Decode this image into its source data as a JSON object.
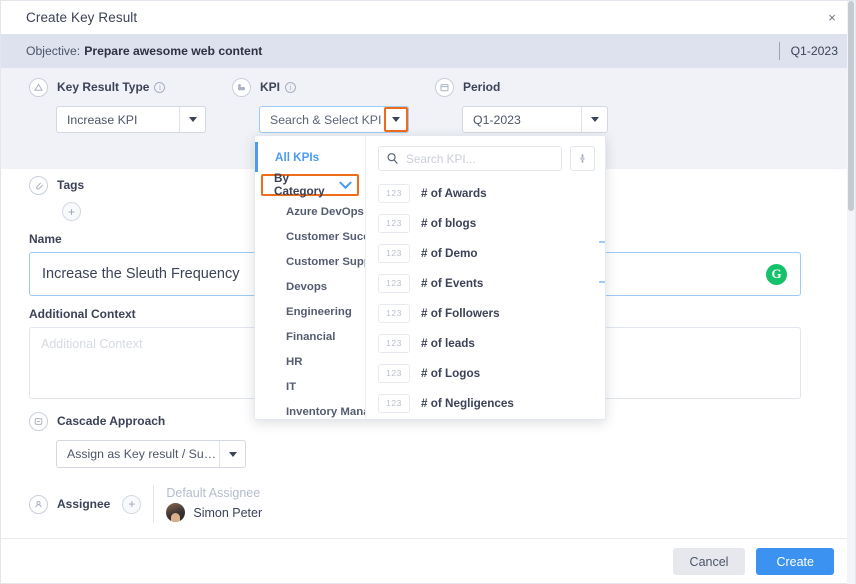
{
  "dialog": {
    "title": "Create Key Result",
    "close_label": "×"
  },
  "objective": {
    "prefix": "Objective:",
    "name": "Prepare awesome web content",
    "period": "Q1-2023"
  },
  "fields": {
    "key_result_type": {
      "label": "Key Result Type",
      "icon": "triangle-circle-icon",
      "info": "i",
      "value": "Increase KPI"
    },
    "kpi": {
      "label": "KPI",
      "icon": "kpi-circle-icon",
      "info": "i",
      "value": "Search & Select KPI"
    },
    "period": {
      "label": "Period",
      "icon": "calendar-circle-icon",
      "value": "Q1-2023"
    },
    "tags": {
      "label": "Tags",
      "icon": "tag-circle-icon",
      "add_label": "+"
    },
    "name": {
      "label": "Name",
      "value": "Increase the Sleuth Frequency",
      "grammarly_glyph": "G"
    },
    "additional_context": {
      "label": "Additional Context",
      "placeholder": "Additional Context",
      "value": ""
    },
    "cascade_approach": {
      "label": "Cascade Approach",
      "icon": "cascade-circle-icon",
      "value": "Assign as Key result / Sub K..."
    },
    "assignee": {
      "label": "Assignee",
      "icon": "assignee-circle-icon",
      "add_label": "+",
      "default_label": "Default Assignee",
      "person": "Simon Peter"
    }
  },
  "kpi_dropdown": {
    "all_kpis_label": "All KPIs",
    "by_category_label": "By Category",
    "categories": [
      "Azure DevOps",
      "Customer Success",
      "Customer Support",
      "Devops",
      "Engineering",
      "Financial",
      "HR",
      "IT",
      "Inventory Manage..."
    ],
    "search_placeholder": "Search KPI...",
    "search_value": "",
    "kpi_badge_text": "123",
    "kpis": [
      "# of Awards",
      "# of blogs",
      "# of Demo",
      "# of Events",
      "# of Followers",
      "# of leads",
      "# of Logos",
      "# of Negligences"
    ]
  },
  "footer": {
    "cancel_label": "Cancel",
    "create_label": "Create"
  },
  "colors": {
    "accent_blue": "#3b92f0",
    "highlight_orange": "#ef6c1a",
    "objective_bar": "#dde2ee",
    "gray_strip": "#f0f2f7",
    "grammarly_green": "#15c26b"
  }
}
